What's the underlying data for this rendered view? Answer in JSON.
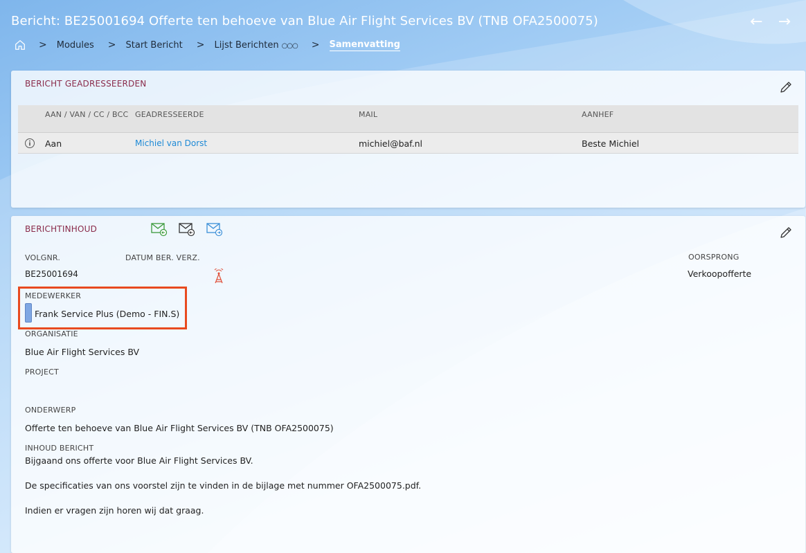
{
  "header": {
    "title": "Bericht: BE25001694 Offerte ten behoeve van Blue Air Flight Services BV (TNB OFA2500075)",
    "back_arrow": "←",
    "forward_arrow": "→"
  },
  "breadcrumb": {
    "items": [
      "Modules",
      "Start Bericht",
      "Lijst Berichten",
      "Samenvatting"
    ],
    "separator": ">",
    "dots": "○○○"
  },
  "addressees": {
    "title": "BERICHT GEADRESSEERDEN",
    "columns": [
      "AAN / VAN / CC / BCC",
      "GEADRESSEERDE",
      "MAIL",
      "AANHEF"
    ],
    "rows": [
      {
        "type": "Aan",
        "name": "Michiel van Dorst",
        "mail": "michiel@baf.nl",
        "salutation": "Beste Michiel"
      }
    ]
  },
  "content": {
    "title": "BERICHTINHOUD",
    "volgnr_label": "VOLGNR.",
    "volgnr": "BE25001694",
    "datum_label": "DATUM BER. VERZ.",
    "oorsprong_label": "OORSPRONG",
    "oorsprong": "Verkoopofferte",
    "medewerker_label": "MEDEWERKER",
    "medewerker": "Frank Service Plus (Demo - FIN.S)",
    "organisatie_label": "ORGANISATIE",
    "organisatie": "Blue Air Flight Services BV",
    "project_label": "PROJECT",
    "onderwerp_label": "ONDERWERP",
    "onderwerp": "Offerte ten behoeve van Blue Air Flight Services BV (TNB OFA2500075)",
    "inhoud_label": "INHOUD BERICHT",
    "body_lines": [
      "Bijgaand ons offerte voor Blue Air Flight Services BV.",
      "De specificaties van ons voorstel zijn te vinden in de bijlage met nummer OFA2500075.pdf.",
      "Indien er vragen zijn horen wij dat graag."
    ]
  },
  "colors": {
    "accent_title": "#8a2b4a",
    "link": "#1e8ad6",
    "highlight": "#e84a1f"
  }
}
